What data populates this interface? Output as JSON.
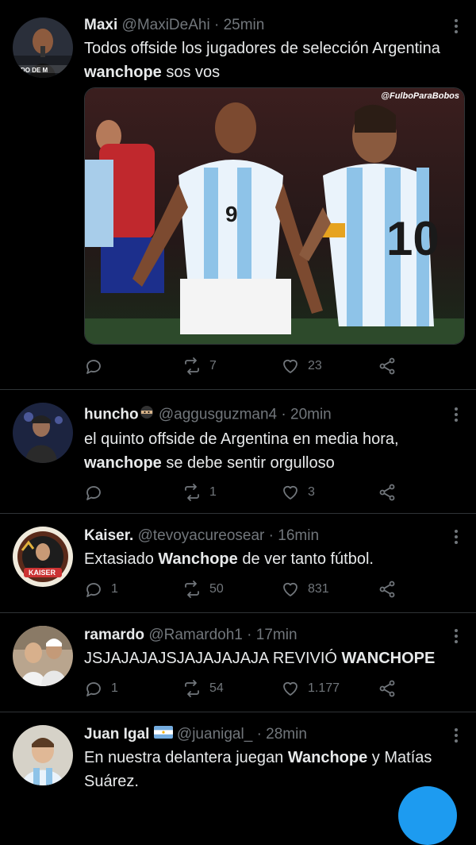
{
  "tweets": [
    {
      "name": "Maxi",
      "handle": "@MaxiDeAhi",
      "time": "· 25min",
      "text_before": "Todos offside los jugadores de selección Argentina ",
      "text_bold": "wanchope",
      "text_after": " sos vos",
      "avatar_caption": "DO DE M",
      "image_watermark": "@FulboParaBobos",
      "replies": "",
      "retweets": "7",
      "likes": "23"
    },
    {
      "name": "huncho",
      "handle": "@aggusguzman4",
      "time": "· 20min",
      "text_before": "el quinto offside de Argentina en media hora, ",
      "text_bold": "wanchope",
      "text_after": " se debe sentir orgulloso",
      "replies": "",
      "retweets": "1",
      "likes": "3"
    },
    {
      "name": "Kaiser.",
      "handle": "@tevoyacureosear",
      "time": "· 16min",
      "text_before": "Extasiado ",
      "text_bold": "Wanchope",
      "text_after": " de ver tanto fútbol.",
      "avatar_caption": "KAISER",
      "replies": "1",
      "retweets": "50",
      "likes": "831"
    },
    {
      "name": "ramardo",
      "handle": "@Ramardoh1",
      "time": "· 17min",
      "text_before": "JSJAJAJAJSJAJAJAJAJA REVIVIÓ ",
      "text_bold": "WANCHOPE",
      "text_after": "",
      "replies": "1",
      "retweets": "54",
      "likes": "1.177"
    },
    {
      "name": "Juan Igal",
      "handle": "@juanigal_",
      "time": "· 28min",
      "text_before": "En nuestra delantera juegan ",
      "text_bold": "Wanchope",
      "text_after": " y Matías Suárez.",
      "replies": "",
      "retweets": "",
      "likes": ""
    }
  ],
  "icons": [
    "reply-icon",
    "retweet-icon",
    "like-icon",
    "share-icon",
    "more-icon",
    "flag-argentina-icon",
    "ninja-emoji-icon"
  ],
  "colors": {
    "background": "#000000",
    "text": "#e7e9ea",
    "muted": "#71767b",
    "divider": "#2f3336",
    "accent": "#1d9bf0"
  }
}
